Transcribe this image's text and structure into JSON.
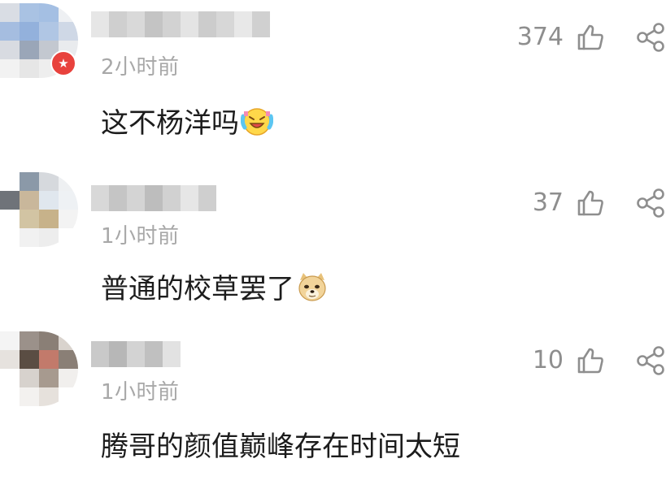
{
  "comments": [
    {
      "time": "2小时前",
      "text": "这不杨洋吗",
      "likes": "374",
      "emoji": "laughing-tears-emoji",
      "has_badge": true,
      "badge_icon": "star-icon"
    },
    {
      "time": "1小时前",
      "text": "普通的校草罢了",
      "likes": "37",
      "emoji": "doge-emoji"
    },
    {
      "time": "1小时前",
      "text": "腾哥的颜值巅峰存在时间太短",
      "likes": "10"
    }
  ],
  "icons": {
    "like": "thumbs-up-icon",
    "share": "share-icon"
  },
  "colors": {
    "text": "#1c1c1c",
    "muted": "#a8a8a8",
    "count": "#8e8e8e",
    "badge": "#e8423d"
  }
}
